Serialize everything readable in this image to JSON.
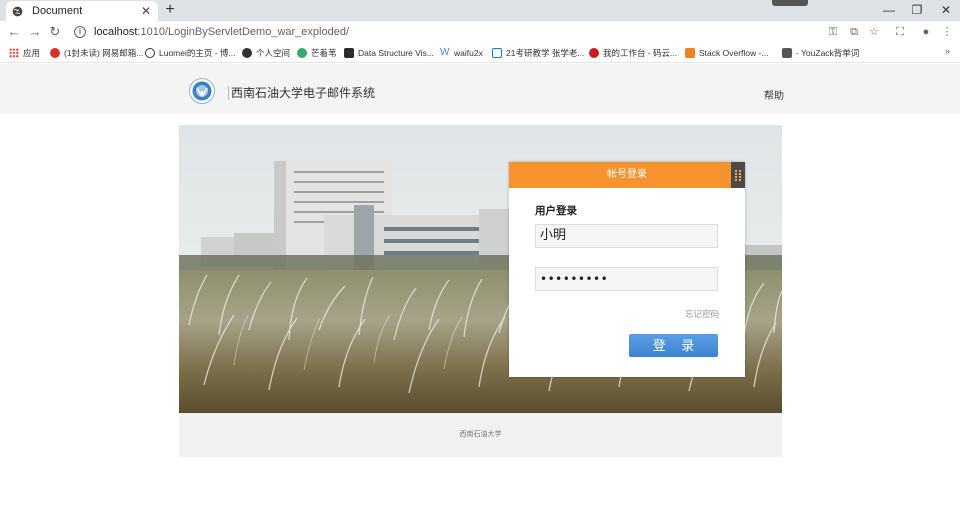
{
  "browser": {
    "tab_title": "Document",
    "new_tab": "+",
    "url_host": "localhost",
    "url_rest": ":1010/LoginByServletDemo_war_exploded/",
    "bookmarks": [
      {
        "label": "应用",
        "color": "#e8453c"
      },
      {
        "label": "(1封未读) 网易邮箱...",
        "color": "#d93025"
      },
      {
        "label": "Luomei的主页 - 博...",
        "color": "#333333"
      },
      {
        "label": "个人空间",
        "color": "#333333"
      },
      {
        "label": "芒着苇",
        "color": "#3aa76d"
      },
      {
        "label": "Data Structure Vis...",
        "color": "#2b2b2b"
      },
      {
        "label": "waifu2x",
        "color": "#4285f4"
      },
      {
        "label": "21考研教学 张学老...",
        "color": "#1a73e8"
      },
      {
        "label": "我的工作台 - 码云...",
        "color": "#c71d23"
      },
      {
        "label": "Stack Overflow -...",
        "color": "#f48024"
      },
      {
        "label": "- YouZack背单词",
        "color": "#555555"
      }
    ],
    "more": "»"
  },
  "header": {
    "site_title": "西南石油大学电子邮件系统",
    "help": "帮助"
  },
  "login": {
    "card_title": "帐号登录",
    "section_label": "用户登录",
    "username": "小明",
    "password_mask": "•••••••••",
    "forgot": "忘记密码",
    "submit": "登 录"
  },
  "footer": {
    "text": "西南石油大学"
  },
  "colors": {
    "accent_orange": "#f5932e",
    "button_blue": "#4a90d9"
  }
}
